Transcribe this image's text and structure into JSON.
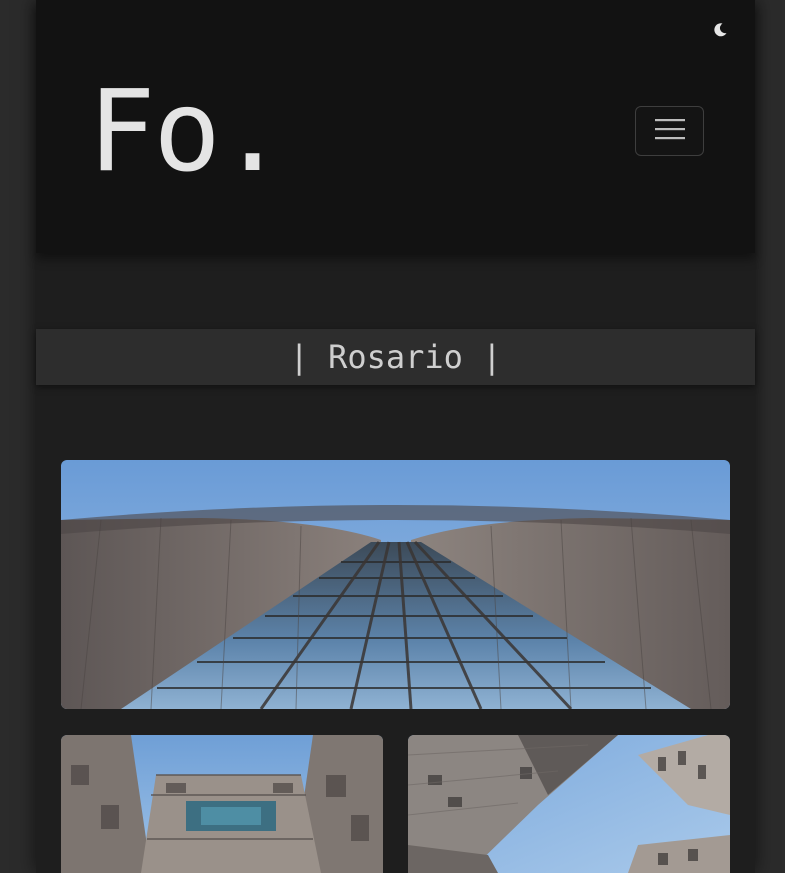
{
  "header": {
    "logo_text": "Fo.",
    "theme_toggle_icon": "moon-icon",
    "menu_icon": "hamburger-menu-icon"
  },
  "album": {
    "title": "| Rosario |"
  },
  "gallery": {
    "photos": [
      {
        "subject": "glass-facade-building-photo"
      },
      {
        "subject": "brutalist-tower-photo"
      },
      {
        "subject": "skyscrapers-upward-view-photo"
      }
    ]
  },
  "colors": {
    "header_background": "#121212",
    "page_background": "#1e1e1e",
    "title_bar_background": "#2d2d2d",
    "text": "#e4e4e4",
    "sky": "#6f9fd6"
  }
}
